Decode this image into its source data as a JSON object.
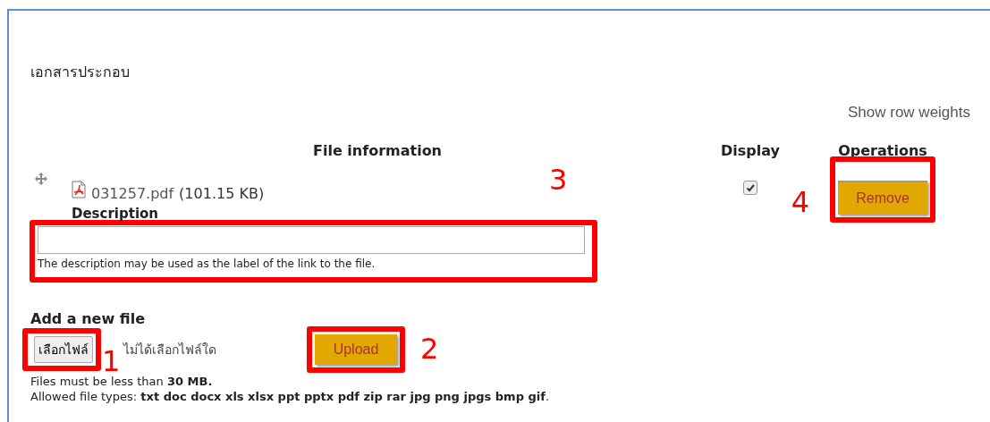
{
  "section_title": "เอกสารประกอบ",
  "row_weights_link": "Show row weights",
  "table": {
    "columns": [
      "File information",
      "Display",
      "Operations"
    ],
    "rows": [
      {
        "file_name": "031257.pdf",
        "file_size": "(101.15 KB)",
        "description_label": "Description",
        "description_hint": "The description may be used as the label of the link to the file.",
        "display_checked": true,
        "remove_button": "Remove"
      }
    ]
  },
  "add_file": {
    "heading": "Add a new file",
    "choose_button": "เลือกไฟล์",
    "no_file_text": "ไม่ได้เลือกไฟล์ใด",
    "upload_button": "Upload",
    "size_hint": "Files must be less than **30 MB.**",
    "types_hint": "Allowed file types: **txt doc docx xls xlsx ppt pptx pdf zip rar jpg png jpgs bmp gif**."
  },
  "annotations": [
    {
      "number": "1"
    },
    {
      "number": "2"
    },
    {
      "number": "3"
    },
    {
      "number": "4"
    }
  ]
}
